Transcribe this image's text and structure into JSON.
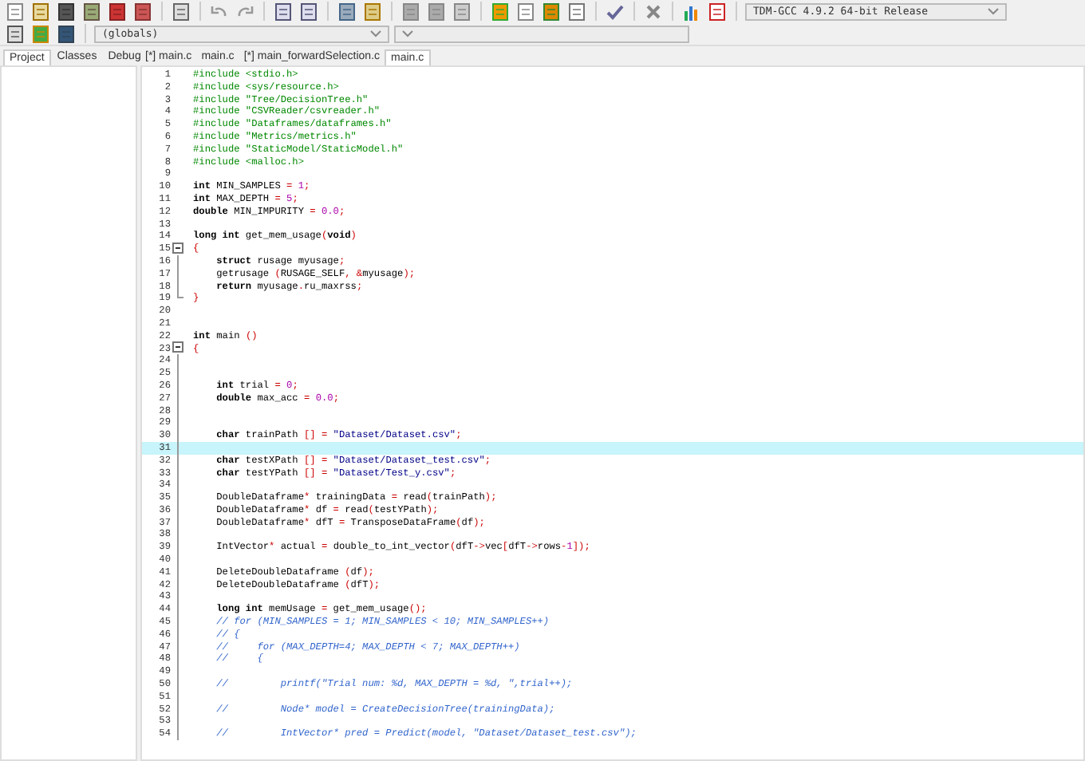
{
  "toolbar": {
    "compiler": "TDM-GCC 4.9.2 64-bit Release",
    "scope": "(globals)"
  },
  "side_tabs": [
    {
      "label": "Project",
      "selected": true
    },
    {
      "label": "Classes",
      "selected": false
    },
    {
      "label": "Debug",
      "selected": false
    }
  ],
  "editor_tabs": [
    {
      "label": "[*] main.c",
      "selected": false
    },
    {
      "label": "main.c",
      "selected": false
    },
    {
      "label": "[*] main_forwardSelection.c",
      "selected": false
    },
    {
      "label": "main.c",
      "selected": true
    }
  ],
  "lines": [
    {
      "n": "1",
      "current": false,
      "kind": "plain",
      "segments": [
        {
          "kind": "pp",
          "text": "#include <stdio.h>"
        }
      ]
    },
    {
      "n": "2",
      "current": false,
      "kind": "plain",
      "segments": [
        {
          "kind": "pp",
          "text": "#include <sys/resource.h>"
        }
      ]
    },
    {
      "n": "3",
      "current": false,
      "kind": "plain",
      "segments": [
        {
          "kind": "pp",
          "text": "#include \"Tree/DecisionTree.h\""
        }
      ]
    },
    {
      "n": "4",
      "current": false,
      "kind": "plain",
      "segments": [
        {
          "kind": "pp",
          "text": "#include \"CSVReader/csvreader.h\""
        }
      ]
    },
    {
      "n": "5",
      "current": false,
      "kind": "plain",
      "segments": [
        {
          "kind": "pp",
          "text": "#include \"Dataframes/dataframes.h\""
        }
      ]
    },
    {
      "n": "6",
      "current": false,
      "kind": "plain",
      "segments": [
        {
          "kind": "pp",
          "text": "#include \"Metrics/metrics.h\""
        }
      ]
    },
    {
      "n": "7",
      "current": false,
      "kind": "plain",
      "segments": [
        {
          "kind": "pp",
          "text": "#include \"StaticModel/StaticModel.h\""
        }
      ]
    },
    {
      "n": "8",
      "current": false,
      "kind": "plain",
      "segments": [
        {
          "kind": "pp",
          "text": "#include <malloc.h>"
        }
      ]
    },
    {
      "n": "9",
      "current": false,
      "kind": "plain"
    },
    {
      "n": "10",
      "current": false,
      "kind": "plain",
      "segments": [
        {
          "kind": "kw",
          "text": "int"
        },
        {
          "kind": "id",
          "text": " MIN_SAMPLES "
        },
        {
          "kind": "op",
          "text": "="
        },
        {
          "kind": "num",
          "text": " 1"
        },
        {
          "kind": "op",
          "text": ";"
        }
      ]
    },
    {
      "n": "11",
      "current": false,
      "kind": "plain",
      "segments": [
        {
          "kind": "kw",
          "text": "int"
        },
        {
          "kind": "id",
          "text": " MAX_DEPTH "
        },
        {
          "kind": "op",
          "text": "="
        },
        {
          "kind": "num",
          "text": " 5"
        },
        {
          "kind": "op",
          "text": ";"
        }
      ]
    },
    {
      "n": "12",
      "current": false,
      "kind": "plain",
      "segments": [
        {
          "kind": "kw",
          "text": "double"
        },
        {
          "kind": "id",
          "text": " MIN_IMPURITY "
        },
        {
          "kind": "op",
          "text": "="
        },
        {
          "kind": "num",
          "text": " 0.0"
        },
        {
          "kind": "op",
          "text": ";"
        }
      ]
    },
    {
      "n": "13",
      "current": false,
      "kind": "plain"
    },
    {
      "n": "14",
      "current": false,
      "kind": "plain",
      "segments": [
        {
          "kind": "kw",
          "text": "long int"
        },
        {
          "kind": "id",
          "text": " get_mem_usage"
        },
        {
          "kind": "op",
          "text": "("
        },
        {
          "kind": "kw",
          "text": "void"
        },
        {
          "kind": "op",
          "text": ")"
        }
      ]
    },
    {
      "n": "15",
      "current": false,
      "kind": "opener",
      "segments": [
        {
          "kind": "op",
          "text": "{"
        }
      ]
    },
    {
      "n": "16",
      "current": false,
      "kind": "inner",
      "segments": [
        {
          "kind": "kw",
          "text": "    struct"
        },
        {
          "kind": "id",
          "text": " rusage myusage"
        },
        {
          "kind": "op",
          "text": ";"
        }
      ]
    },
    {
      "n": "17",
      "current": false,
      "kind": "inner",
      "segments": [
        {
          "kind": "id",
          "text": "    getrusage "
        },
        {
          "kind": "op",
          "text": "("
        },
        {
          "kind": "id",
          "text": "RUSAGE_SELF"
        },
        {
          "kind": "op",
          "text": ", &"
        },
        {
          "kind": "id",
          "text": "myusage"
        },
        {
          "kind": "op",
          "text": ");"
        }
      ]
    },
    {
      "n": "18",
      "current": false,
      "kind": "inner",
      "segments": [
        {
          "kind": "kw",
          "text": "    return"
        },
        {
          "kind": "id",
          "text": " myusage"
        },
        {
          "kind": "op",
          "text": "."
        },
        {
          "kind": "id",
          "text": "ru_maxrss"
        },
        {
          "kind": "op",
          "text": ";"
        }
      ]
    },
    {
      "n": "19",
      "current": false,
      "kind": "closer",
      "segments": [
        {
          "kind": "op",
          "text": "}"
        }
      ]
    },
    {
      "n": "20",
      "current": false,
      "kind": "plain"
    },
    {
      "n": "21",
      "current": false,
      "kind": "plain"
    },
    {
      "n": "22",
      "current": false,
      "kind": "plain",
      "segments": [
        {
          "kind": "kw",
          "text": "int"
        },
        {
          "kind": "id",
          "text": " main "
        },
        {
          "kind": "op",
          "text": "()"
        }
      ]
    },
    {
      "n": "23",
      "current": false,
      "kind": "opener",
      "segments": [
        {
          "kind": "op",
          "text": "{"
        }
      ]
    },
    {
      "n": "24",
      "current": false,
      "kind": "inner"
    },
    {
      "n": "25",
      "current": false,
      "kind": "inner"
    },
    {
      "n": "26",
      "current": false,
      "kind": "inner",
      "segments": [
        {
          "kind": "kw",
          "text": "    int"
        },
        {
          "kind": "id",
          "text": " trial "
        },
        {
          "kind": "op",
          "text": "="
        },
        {
          "kind": "num",
          "text": " 0"
        },
        {
          "kind": "op",
          "text": ";"
        }
      ]
    },
    {
      "n": "27",
      "current": false,
      "kind": "inner",
      "segments": [
        {
          "kind": "kw",
          "text": "    double"
        },
        {
          "kind": "id",
          "text": " max_acc "
        },
        {
          "kind": "op",
          "text": "="
        },
        {
          "kind": "num",
          "text": " 0.0"
        },
        {
          "kind": "op",
          "text": ";"
        }
      ]
    },
    {
      "n": "28",
      "current": false,
      "kind": "inner"
    },
    {
      "n": "29",
      "current": false,
      "kind": "inner"
    },
    {
      "n": "30",
      "current": false,
      "kind": "inner",
      "segments": [
        {
          "kind": "kw",
          "text": "    char"
        },
        {
          "kind": "id",
          "text": " trainPath "
        },
        {
          "kind": "op",
          "text": "[] ="
        },
        {
          "kind": "str",
          "text": " \"Dataset/Dataset.csv\""
        },
        {
          "kind": "op",
          "text": ";"
        }
      ]
    },
    {
      "n": "31",
      "current": true,
      "kind": "inner"
    },
    {
      "n": "32",
      "current": false,
      "kind": "inner",
      "segments": [
        {
          "kind": "kw",
          "text": "    char"
        },
        {
          "kind": "id",
          "text": " testXPath "
        },
        {
          "kind": "op",
          "text": "[] ="
        },
        {
          "kind": "str",
          "text": " \"Dataset/Dataset_test.csv\""
        },
        {
          "kind": "op",
          "text": ";"
        }
      ]
    },
    {
      "n": "33",
      "current": false,
      "kind": "inner",
      "segments": [
        {
          "kind": "kw",
          "text": "    char"
        },
        {
          "kind": "id",
          "text": " testYPath "
        },
        {
          "kind": "op",
          "text": "[] ="
        },
        {
          "kind": "str",
          "text": " \"Dataset/Test_y.csv\""
        },
        {
          "kind": "op",
          "text": ";"
        }
      ]
    },
    {
      "n": "34",
      "current": false,
      "kind": "inner"
    },
    {
      "n": "35",
      "current": false,
      "kind": "inner",
      "segments": [
        {
          "kind": "id",
          "text": "    DoubleDataframe"
        },
        {
          "kind": "op",
          "text": "*"
        },
        {
          "kind": "id",
          "text": " trainingData "
        },
        {
          "kind": "op",
          "text": "="
        },
        {
          "kind": "id",
          "text": " read"
        },
        {
          "kind": "op",
          "text": "("
        },
        {
          "kind": "id",
          "text": "trainPath"
        },
        {
          "kind": "op",
          "text": ");"
        }
      ]
    },
    {
      "n": "36",
      "current": false,
      "kind": "inner",
      "segments": [
        {
          "kind": "id",
          "text": "    DoubleDataframe"
        },
        {
          "kind": "op",
          "text": "*"
        },
        {
          "kind": "id",
          "text": " df "
        },
        {
          "kind": "op",
          "text": "="
        },
        {
          "kind": "id",
          "text": " read"
        },
        {
          "kind": "op",
          "text": "("
        },
        {
          "kind": "id",
          "text": "testYPath"
        },
        {
          "kind": "op",
          "text": ");"
        }
      ]
    },
    {
      "n": "37",
      "current": false,
      "kind": "inner",
      "segments": [
        {
          "kind": "id",
          "text": "    DoubleDataframe"
        },
        {
          "kind": "op",
          "text": "*"
        },
        {
          "kind": "id",
          "text": " dfT "
        },
        {
          "kind": "op",
          "text": "="
        },
        {
          "kind": "id",
          "text": " TransposeDataFrame"
        },
        {
          "kind": "op",
          "text": "("
        },
        {
          "kind": "id",
          "text": "df"
        },
        {
          "kind": "op",
          "text": ");"
        }
      ]
    },
    {
      "n": "38",
      "current": false,
      "kind": "inner"
    },
    {
      "n": "39",
      "current": false,
      "kind": "inner",
      "segments": [
        {
          "kind": "id",
          "text": "    IntVector"
        },
        {
          "kind": "op",
          "text": "*"
        },
        {
          "kind": "id",
          "text": " actual "
        },
        {
          "kind": "op",
          "text": "="
        },
        {
          "kind": "id",
          "text": " double_to_int_vector"
        },
        {
          "kind": "op",
          "text": "("
        },
        {
          "kind": "id",
          "text": "dfT"
        },
        {
          "kind": "op",
          "text": "->"
        },
        {
          "kind": "id",
          "text": "vec"
        },
        {
          "kind": "op",
          "text": "["
        },
        {
          "kind": "id",
          "text": "dfT"
        },
        {
          "kind": "op",
          "text": "->"
        },
        {
          "kind": "id",
          "text": "rows"
        },
        {
          "kind": "op",
          "text": "-"
        },
        {
          "kind": "num",
          "text": "1"
        },
        {
          "kind": "op",
          "text": "]);"
        }
      ]
    },
    {
      "n": "40",
      "current": false,
      "kind": "inner"
    },
    {
      "n": "41",
      "current": false,
      "kind": "inner",
      "segments": [
        {
          "kind": "id",
          "text": "    DeleteDoubleDataframe "
        },
        {
          "kind": "op",
          "text": "("
        },
        {
          "kind": "id",
          "text": "df"
        },
        {
          "kind": "op",
          "text": ");"
        }
      ]
    },
    {
      "n": "42",
      "current": false,
      "kind": "inner",
      "segments": [
        {
          "kind": "id",
          "text": "    DeleteDoubleDataframe "
        },
        {
          "kind": "op",
          "text": "("
        },
        {
          "kind": "id",
          "text": "dfT"
        },
        {
          "kind": "op",
          "text": ");"
        }
      ]
    },
    {
      "n": "43",
      "current": false,
      "kind": "inner"
    },
    {
      "n": "44",
      "current": false,
      "kind": "inner",
      "segments": [
        {
          "kind": "kw",
          "text": "    long int"
        },
        {
          "kind": "id",
          "text": " memUsage "
        },
        {
          "kind": "op",
          "text": "="
        },
        {
          "kind": "id",
          "text": " get_mem_usage"
        },
        {
          "kind": "op",
          "text": "();"
        }
      ]
    },
    {
      "n": "45",
      "current": false,
      "kind": "inner",
      "segments": [
        {
          "kind": "cm",
          "text": "    // for (MIN_SAMPLES = 1; MIN_SAMPLES < 10; MIN_SAMPLES++)"
        }
      ]
    },
    {
      "n": "46",
      "current": false,
      "kind": "inner",
      "segments": [
        {
          "kind": "cm",
          "text": "    // {"
        }
      ]
    },
    {
      "n": "47",
      "current": false,
      "kind": "inner",
      "segments": [
        {
          "kind": "cm",
          "text": "    //     for (MAX_DEPTH=4; MAX_DEPTH < 7; MAX_DEPTH++)"
        }
      ]
    },
    {
      "n": "48",
      "current": false,
      "kind": "inner",
      "segments": [
        {
          "kind": "cm",
          "text": "    //     {"
        }
      ]
    },
    {
      "n": "49",
      "current": false,
      "kind": "inner"
    },
    {
      "n": "50",
      "current": false,
      "kind": "inner",
      "segments": [
        {
          "kind": "cm",
          "text": "    //         printf(\"Trial num: %d, MAX_DEPTH = %d, \",trial++);"
        }
      ]
    },
    {
      "n": "51",
      "current": false,
      "kind": "inner"
    },
    {
      "n": "52",
      "current": false,
      "kind": "inner",
      "segments": [
        {
          "kind": "cm",
          "text": "    //         Node* model = CreateDecisionTree(trainingData);"
        }
      ]
    },
    {
      "n": "53",
      "current": false,
      "kind": "inner"
    },
    {
      "n": "54",
      "current": false,
      "kind": "inner",
      "segments": [
        {
          "kind": "cm",
          "text": "    //         IntVector* pred = Predict(model, \"Dataset/Dataset_test.csv\");"
        }
      ]
    }
  ]
}
